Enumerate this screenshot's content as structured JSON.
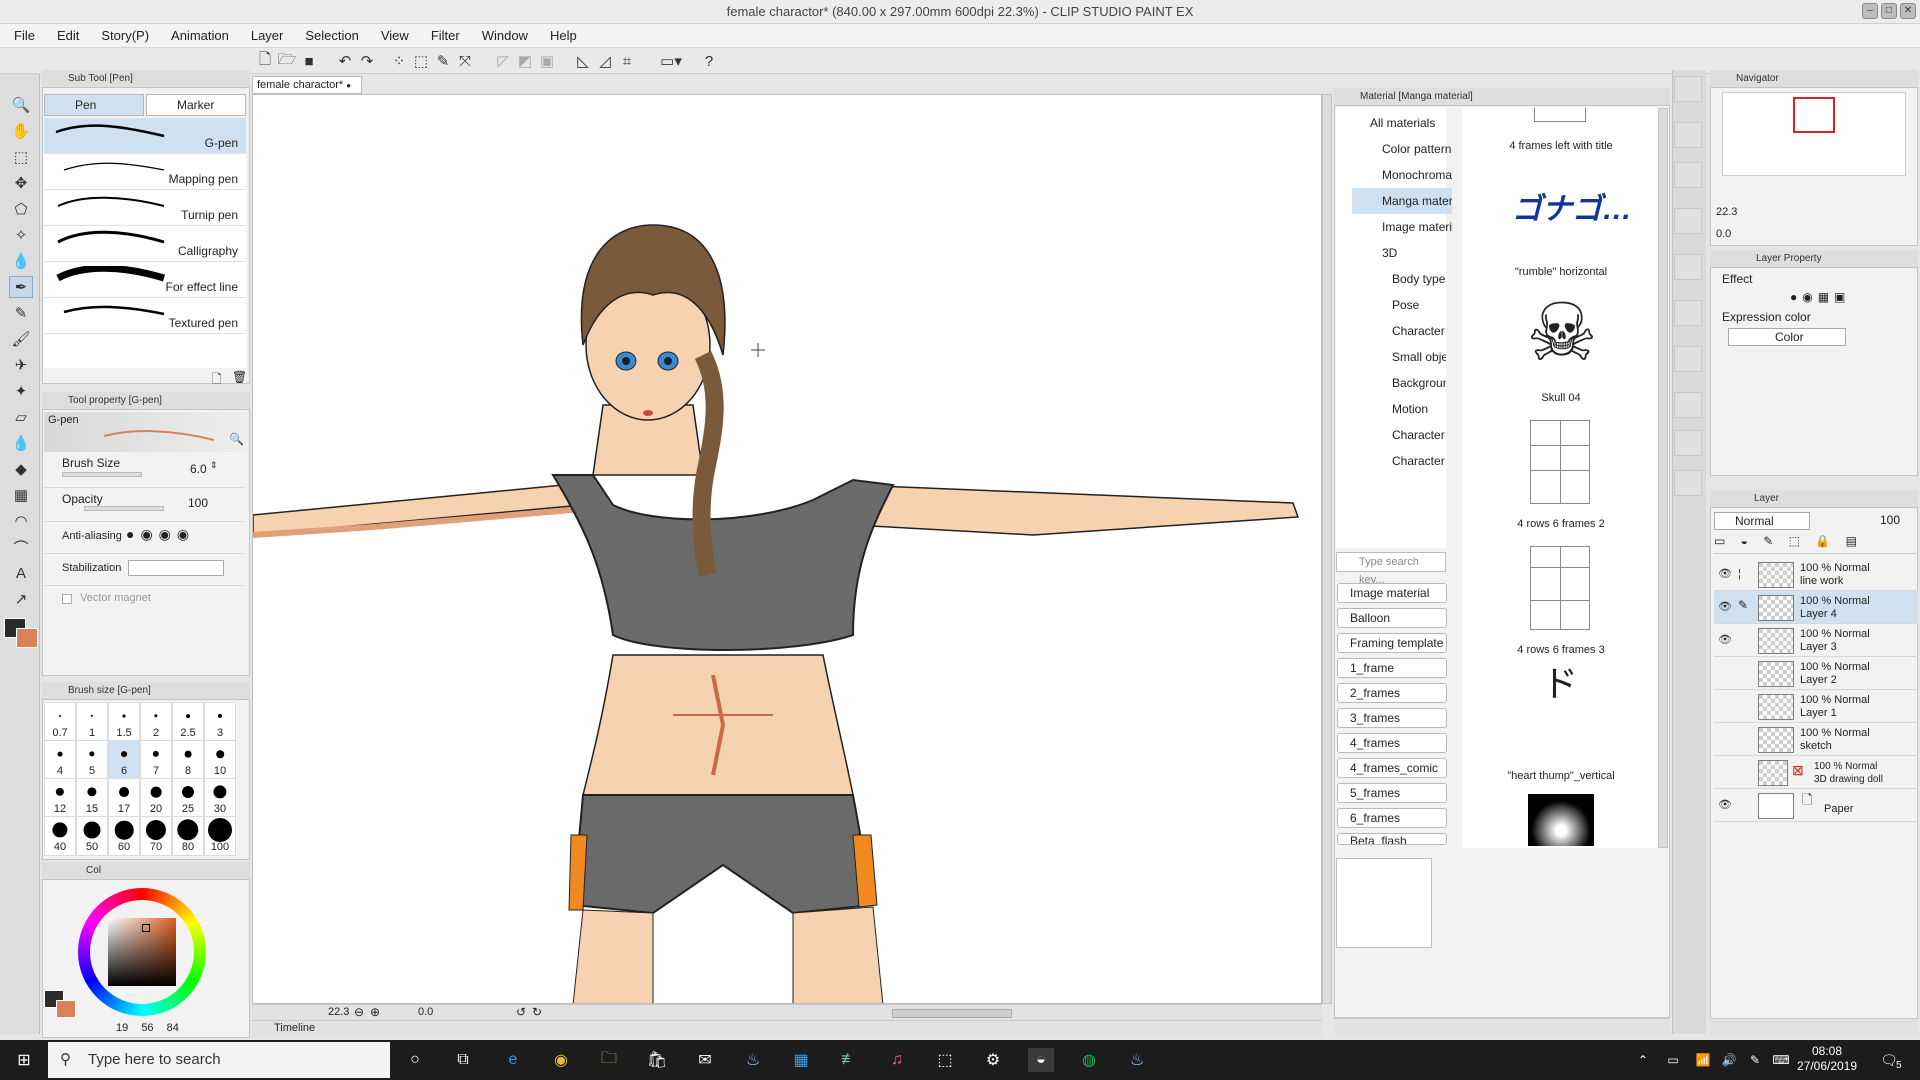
{
  "window": {
    "title": "female charactor* (840.00 x 297.00mm 600dpi 22.3%) - CLIP STUDIO PAINT EX"
  },
  "menu": [
    "File",
    "Edit",
    "Story(P)",
    "Animation",
    "Layer",
    "Selection",
    "View",
    "Filter",
    "Window",
    "Help"
  ],
  "subtool_panel": {
    "header": "Sub Tool [Pen]",
    "tabs": [
      "Pen",
      "Marker"
    ],
    "brushes": [
      "G-pen",
      "Mapping pen",
      "Turnip pen",
      "Calligraphy",
      "For effect line",
      "Textured pen"
    ],
    "selected_brush": "G-pen"
  },
  "tool_property": {
    "header": "Tool property [G-pen]",
    "preview_label": "G-pen",
    "brush_size_label": "Brush Size",
    "brush_size_value": "6.0",
    "opacity_label": "Opacity",
    "opacity_value": "100",
    "antialias_label": "Anti-aliasing",
    "stabilization_label": "Stabilization",
    "vector_magnet_label": "Vector magnet"
  },
  "brush_size_panel": {
    "header": "Brush size [G-pen]",
    "sizes": [
      "0.7",
      "1",
      "1.5",
      "2",
      "2.5",
      "3",
      "4",
      "5",
      "6",
      "7",
      "8",
      "10",
      "12",
      "15",
      "17",
      "20",
      "25",
      "30",
      "40",
      "50",
      "60",
      "70",
      "80",
      "100"
    ],
    "selected": "6"
  },
  "color_panel": {
    "tab_label": "Col",
    "readout": [
      "19",
      "56",
      "84"
    ],
    "main_color": "#2b2b2b",
    "sub_color": "#d9825a"
  },
  "document": {
    "tab_label": "female charactor*"
  },
  "canvas_status": {
    "zoom": "22.3",
    "angle": "0.0",
    "timeline_label": "Timeline"
  },
  "material_panel": {
    "header": "Material [Manga material]",
    "tree": [
      {
        "label": "All materials"
      },
      {
        "label": "Color pattern"
      },
      {
        "label": "Monochromatic"
      },
      {
        "label": "Manga material"
      },
      {
        "label": "Image material"
      },
      {
        "label": "3D"
      },
      {
        "label": "Body type"
      },
      {
        "label": "Pose"
      },
      {
        "label": "Character"
      },
      {
        "label": "Small objects"
      },
      {
        "label": "Background"
      },
      {
        "label": "Motion"
      },
      {
        "label": "Character parts"
      },
      {
        "label": "Character Template"
      }
    ],
    "search_placeholder": "Type search key...",
    "tags": [
      "Image material",
      "Balloon",
      "Framing template",
      "1_frame",
      "2_frames",
      "3_frames",
      "4_frames",
      "4_frames_comic",
      "5_frames",
      "6_frames",
      "Beta_flash"
    ],
    "items": [
      {
        "caption": "4 frames left with title"
      },
      {
        "caption": "\"rumble\" horizontal"
      },
      {
        "caption": "Skull 04"
      },
      {
        "caption": "4 rows 6 frames 2"
      },
      {
        "caption": "4 rows 6 frames 3"
      },
      {
        "caption": "\"heart thump\"_vertical"
      }
    ],
    "rumble_glyphs": "ゴナゴ…"
  },
  "navigator": {
    "header": "Navigator",
    "zoom": "22.3",
    "angle": "0.0"
  },
  "layer_property": {
    "header": "Layer Property",
    "effect_label": "Effect",
    "expression_color_label": "Expression color",
    "expression_color_value": "Color"
  },
  "layer_panel": {
    "header": "Layer",
    "blend_mode": "Normal",
    "opacity": "100",
    "layers": [
      {
        "opacity": "100 %",
        "mode": "Normal",
        "name": "line work"
      },
      {
        "opacity": "100 %",
        "mode": "Normal",
        "name": "Layer 4"
      },
      {
        "opacity": "100 %",
        "mode": "Normal",
        "name": "Layer 3"
      },
      {
        "opacity": "100 %",
        "mode": "Normal",
        "name": "Layer 2"
      },
      {
        "opacity": "100 %",
        "mode": "Normal",
        "name": "Layer 1"
      },
      {
        "opacity": "100 %",
        "mode": "Normal",
        "name": "sketch"
      },
      {
        "opacity": "100 %",
        "mode": "Normal",
        "name": "3D drawing doll"
      },
      {
        "opacity": "",
        "mode": "",
        "name": "Paper"
      }
    ],
    "selected_layer": "Layer 4"
  },
  "taskbar": {
    "search_placeholder": "Type here to search",
    "time": "08:08",
    "date": "27/06/2019",
    "notification_count": "5"
  }
}
